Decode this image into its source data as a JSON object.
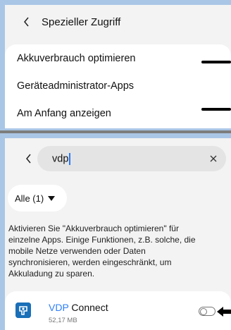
{
  "top_screen": {
    "header": {
      "title": "Spezieller Zugriff"
    },
    "menu_items": [
      {
        "label": "Akkuverbrauch optimieren"
      },
      {
        "label": "Geräteadministrator-Apps"
      },
      {
        "label": "Am Anfang anzeigen"
      }
    ]
  },
  "bottom_screen": {
    "search": {
      "value": "vdp"
    },
    "filter": {
      "label": "Alle (1)"
    },
    "description": "Aktivieren Sie \"Akkuverbrauch optimieren\" für einzelne Apps. Einige Funktionen, z.B. solche, die mobile Netze verwenden oder Daten synchronisieren, werden eingeschränkt, um Akkuladung zu sparen.",
    "app": {
      "name_highlight": "VDP",
      "name_rest": " Connect",
      "size": "52,17 MB",
      "toggle_on": false,
      "icon": "vdp-connect-app-icon"
    }
  },
  "colors": {
    "background": "#aac6e6",
    "panel": "#f3f3f3",
    "highlight": "#2d7ff9"
  }
}
